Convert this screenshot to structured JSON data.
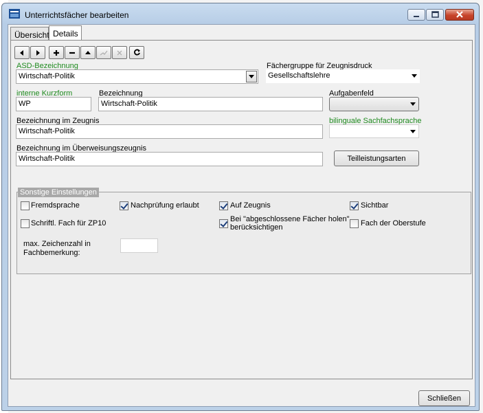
{
  "window": {
    "title": "Unterrichtsfächer bearbeiten"
  },
  "tabs": [
    {
      "label": "Übersicht"
    },
    {
      "label": "Details"
    }
  ],
  "toolbar": [
    {
      "icon": "arrow-left-icon"
    },
    {
      "icon": "arrow-right-icon"
    },
    {
      "icon": "plus-icon"
    },
    {
      "icon": "minus-icon"
    },
    {
      "icon": "arrow-up-icon"
    },
    {
      "icon": "confirm-icon"
    },
    {
      "icon": "cancel-icon"
    },
    {
      "icon": "refresh-icon"
    }
  ],
  "fields": {
    "asd_label": "ASD-Bezeichnung",
    "asd_value": "Wirtschaft-Politik",
    "faechergruppe_label": "Fächergruppe für Zeugnisdruck",
    "faechergruppe_value": "Gesellschaftslehre",
    "kurzform_label": "interne Kurzform",
    "kurzform_value": "WP",
    "bezeichnung_label": "Bezeichnung",
    "bezeichnung_value": "Wirtschaft-Politik",
    "aufgabenfeld_label": "Aufgabenfeld",
    "aufgabenfeld_value": "",
    "zeugnis_label": "Bezeichnung im Zeugnis",
    "zeugnis_value": "Wirtschaft-Politik",
    "bilingual_label": "bilinguale Sachfachsprache",
    "bilingual_value": "",
    "ueberweisung_label": "Bezeichnung im Überweisungszeugnis",
    "ueberweisung_value": "Wirtschaft-Politik",
    "teilleistung_button": "Teilleistungsarten"
  },
  "sonstige": {
    "title": "Sonstige Einstellungen",
    "checkboxes": [
      {
        "label": "Fremdsprache",
        "checked": false
      },
      {
        "label": "Nachprüfung erlaubt",
        "checked": true
      },
      {
        "label": "Auf Zeugnis",
        "checked": true
      },
      {
        "label": "Sichtbar",
        "checked": true
      },
      {
        "label": "Schriftl. Fach für ZP10",
        "checked": false
      },
      {
        "label": "Bei \"abgeschlossene Fächer holen\"",
        "label2": "berücksichtigen",
        "checked": true
      },
      {
        "label": "Fach der Oberstufe",
        "checked": false
      }
    ],
    "max_zeichen_label1": "max. Zeichenzahl in",
    "max_zeichen_label2": "Fachbemerkung:",
    "max_zeichen_value": ""
  },
  "footer": {
    "close_button": "Schließen"
  },
  "colors": {
    "accent_green": "#1f8a1f",
    "title_bar": "#b7cde6"
  }
}
